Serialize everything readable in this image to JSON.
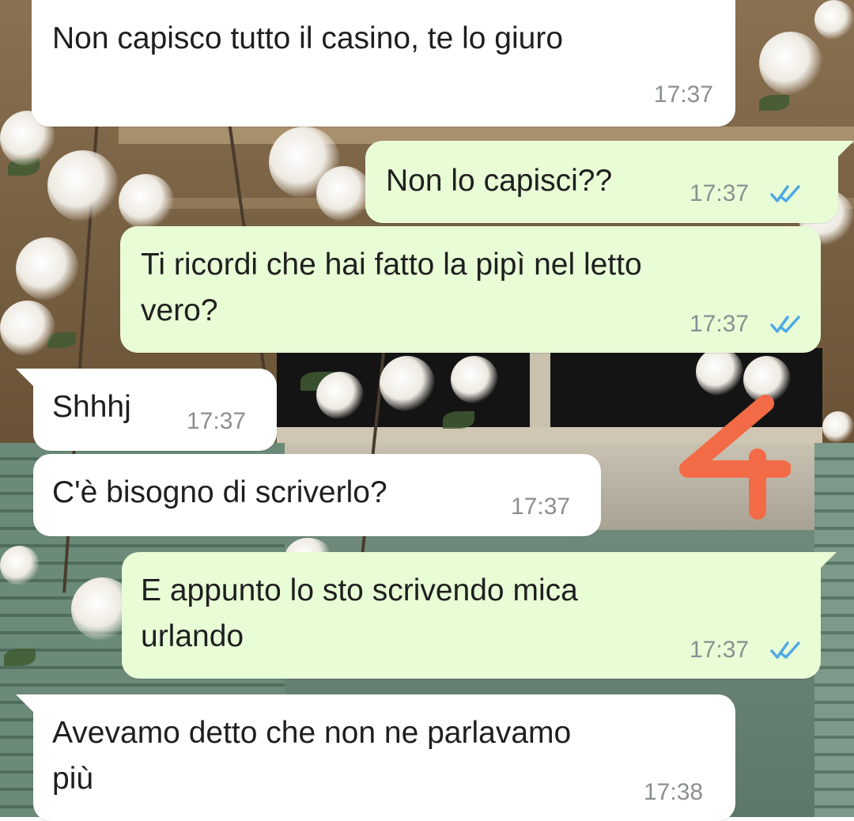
{
  "chat": {
    "messages": [
      {
        "id": "m1",
        "direction": "incoming",
        "text": "Non capisco tutto il casino, te lo giuro",
        "time": "17:37"
      },
      {
        "id": "m2",
        "direction": "outgoing",
        "text": "Non lo capisci??",
        "time": "17:37",
        "status": "read"
      },
      {
        "id": "m3",
        "direction": "outgoing",
        "text": "Ti ricordi che hai fatto la pipì nel letto\nvero?",
        "time": "17:37",
        "status": "read"
      },
      {
        "id": "m4",
        "direction": "incoming",
        "text": "Shhhj",
        "time": "17:37"
      },
      {
        "id": "m5",
        "direction": "incoming",
        "text": "C'è bisogno di scriverlo?",
        "time": "17:37"
      },
      {
        "id": "m6",
        "direction": "outgoing",
        "text": "E appunto lo sto scrivendo mica\nurlando",
        "time": "17:37",
        "status": "read"
      },
      {
        "id": "m7",
        "direction": "incoming",
        "text": "Avevamo detto che non ne parlavamo\npiù",
        "time": "17:38"
      }
    ]
  },
  "annotation": {
    "text": "4",
    "color": "#f26b46"
  },
  "colors": {
    "incoming_bubble": "#ffffff",
    "outgoing_bubble": "#e8fdd6",
    "read_ticks": "#4fa8e6",
    "time_text": "#8a8f92"
  }
}
